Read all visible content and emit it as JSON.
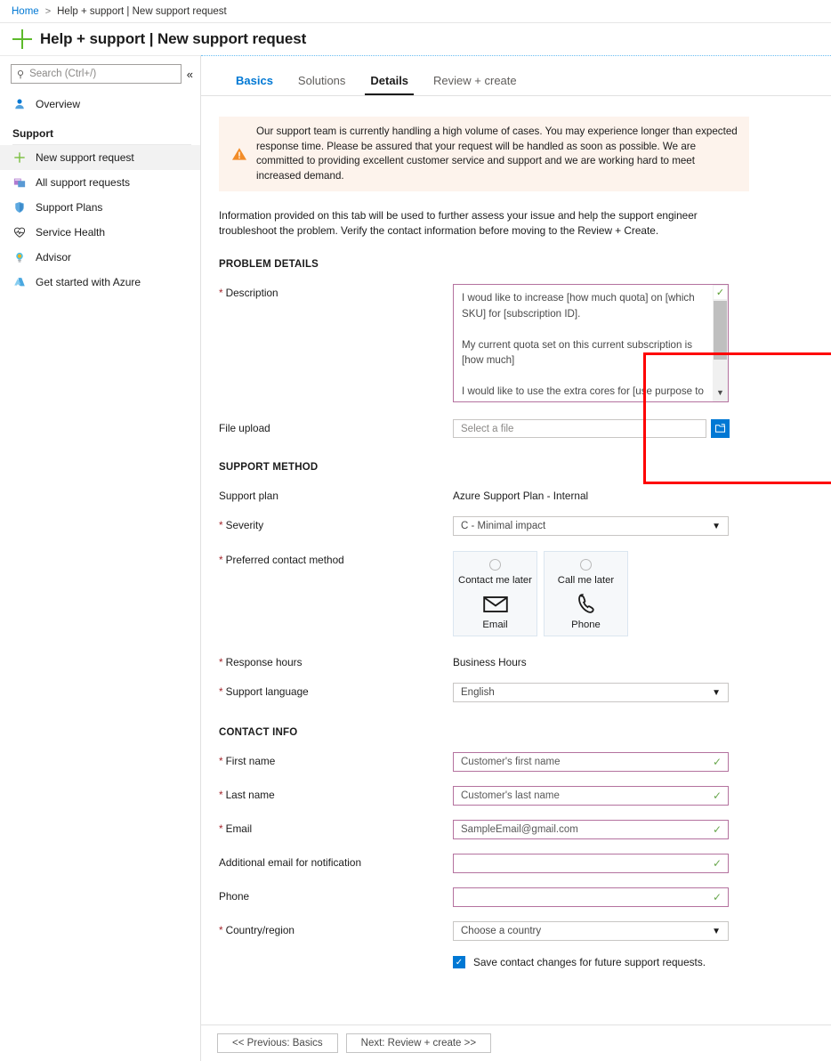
{
  "breadcrumb": {
    "home": "Home",
    "separator": ">",
    "current": "Help + support | New support request"
  },
  "header": {
    "title": "Help + support | New support request",
    "plus_icon": "plus-icon",
    "accent_green": "#5dba2b"
  },
  "sidebar": {
    "search": {
      "placeholder": "Search (Ctrl+/)",
      "icon": "search-icon"
    },
    "collapse_icon": "«",
    "items": [
      {
        "label": "Overview",
        "icon": "person-icon",
        "selected": false
      }
    ],
    "group_label": "Support",
    "support_items": [
      {
        "label": "New support request",
        "icon": "plus-icon",
        "selected": true
      },
      {
        "label": "All support requests",
        "icon": "requests-icon",
        "selected": false
      },
      {
        "label": "Support Plans",
        "icon": "shield-icon",
        "selected": false
      },
      {
        "label": "Service Health",
        "icon": "heart-pulse-icon",
        "selected": false
      },
      {
        "label": "Advisor",
        "icon": "advisor-icon",
        "selected": false
      },
      {
        "label": "Get started with Azure",
        "icon": "azure-icon",
        "selected": false
      }
    ]
  },
  "tabs": [
    {
      "label": "Basics",
      "state": "link"
    },
    {
      "label": "Solutions",
      "state": "inactive"
    },
    {
      "label": "Details",
      "state": "active"
    },
    {
      "label": "Review + create",
      "state": "inactive"
    }
  ],
  "banner": {
    "icon": "warning-icon",
    "background": "#fdf3ec",
    "icon_color": "#f28c28",
    "text": "Our support team is currently handling a high volume of cases. You may experience longer than expected response time. Please be assured that your request will be handled as soon as possible. We are committed to providing excellent customer service and support and we are working hard to meet increased demand."
  },
  "intro_text": "Information provided on this tab will be used to further assess your issue and help the support engineer troubleshoot the problem. Verify the contact information before moving to the Review + Create.",
  "problem_details": {
    "heading": "PROBLEM DETAILS",
    "description": {
      "label": "Description",
      "required": true,
      "value": "I woud like to increase [how much quota] on [which SKU] for [subscription ID].\n\nMy current quota set on this current subscription is [how much]\n\nI would like to use the extra cores for [use purpose to call out why the extra cores are important]",
      "valid_icon": "check-icon",
      "scroll_down_icon": "▼",
      "highlight_color": "#fe0000"
    },
    "file_upload": {
      "label": "File upload",
      "required": false,
      "placeholder": "Select a file",
      "browse_icon": "folder-browse-icon",
      "browse_color": "#0078d4"
    }
  },
  "support_method": {
    "heading": "SUPPORT METHOD",
    "support_plan": {
      "label": "Support plan",
      "required": false,
      "value": "Azure Support Plan - Internal"
    },
    "severity": {
      "label": "Severity",
      "required": true,
      "value": "C - Minimal impact",
      "chevron": "chevron-down-icon"
    },
    "preferred_contact_method": {
      "label": "Preferred contact method",
      "required": true,
      "options": [
        {
          "title": "Contact me later",
          "kind": "Email",
          "icon": "envelope-icon",
          "selected": false
        },
        {
          "title": "Call me later",
          "kind": "Phone",
          "icon": "phone-icon",
          "selected": false
        }
      ]
    },
    "response_hours": {
      "label": "Response hours",
      "required": true,
      "value": "Business Hours"
    },
    "support_language": {
      "label": "Support language",
      "required": true,
      "value": "English",
      "chevron": "chevron-down-icon"
    }
  },
  "contact_info": {
    "heading": "CONTACT INFO",
    "fields": [
      {
        "label": "First name",
        "required": true,
        "value": "Customer's first name",
        "valid": true
      },
      {
        "label": "Last name",
        "required": true,
        "value": "Customer's last name",
        "valid": true
      },
      {
        "label": "Email",
        "required": true,
        "value": "SampleEmail@gmail.com",
        "valid": true
      },
      {
        "label": "Additional email for notification",
        "required": false,
        "value": "",
        "valid": true
      },
      {
        "label": "Phone",
        "required": false,
        "value": "",
        "valid": true
      }
    ],
    "country": {
      "label": "Country/region",
      "required": true,
      "value": "Choose a country",
      "chevron": "chevron-down-icon"
    },
    "save_contact": {
      "label": "Save contact changes for future support requests.",
      "checked": true,
      "color": "#0078d4"
    }
  },
  "footer": {
    "previous": "<< Previous: Basics",
    "next": "Next: Review + create >>"
  }
}
